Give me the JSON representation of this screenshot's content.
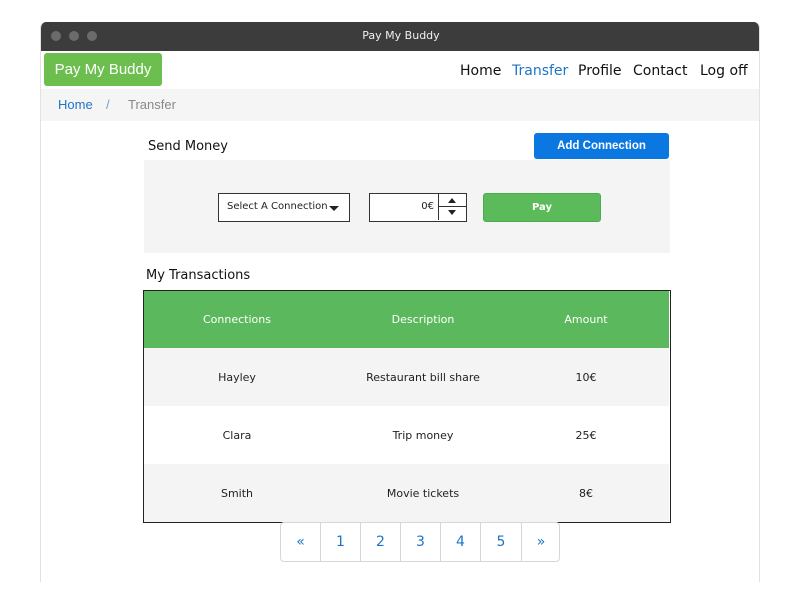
{
  "window": {
    "title": "Pay My Buddy"
  },
  "navbar": {
    "brand": "Pay My Buddy",
    "links": [
      {
        "label": "Home",
        "active": false
      },
      {
        "label": "Transfer",
        "active": true
      },
      {
        "label": "Profile",
        "active": false
      },
      {
        "label": "Contact",
        "active": false
      },
      {
        "label": "Log off",
        "active": false
      }
    ]
  },
  "breadcrumb": {
    "home": "Home",
    "separator": "/",
    "current": "Transfer"
  },
  "send_money": {
    "title": "Send Money",
    "add_connection_label": "Add Connection",
    "select_value": "Select A Connection",
    "amount_value": "0€",
    "pay_label": "Pay"
  },
  "transactions": {
    "title": "My Transactions",
    "columns": [
      "Connections",
      "Description",
      "Amount"
    ],
    "rows": [
      {
        "connection": "Hayley",
        "description": "Restaurant bill share",
        "amount": "10€"
      },
      {
        "connection": "Clara",
        "description": "Trip money",
        "amount": "25€"
      },
      {
        "connection": "Smith",
        "description": "Movie tickets",
        "amount": "8€"
      }
    ]
  },
  "pagination": {
    "prev": "«",
    "pages": [
      "1",
      "2",
      "3",
      "4",
      "5"
    ],
    "next": "»"
  },
  "colors": {
    "brand_green": "#6cbf4f",
    "table_header_green": "#5cb85c",
    "primary_blue": "#0b77e0",
    "link_blue": "#1f74c4",
    "titlebar": "#3c3c3c"
  },
  "icons": {
    "select_arrow": "caret-down-icon",
    "stepper_up": "caret-up-icon",
    "stepper_down": "caret-down-icon"
  }
}
